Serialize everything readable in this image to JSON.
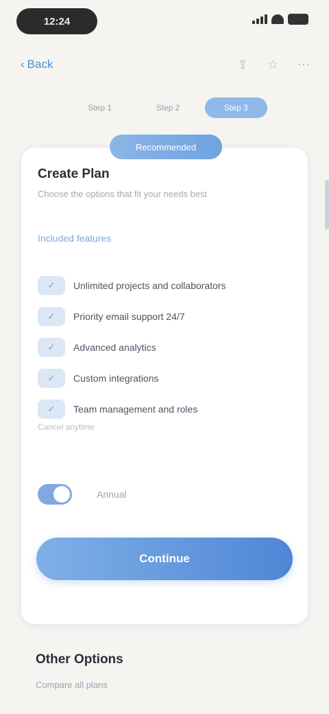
{
  "status": {
    "time": "12:24"
  },
  "nav": {
    "back_label": "Back",
    "icons": [
      "share-icon",
      "star-icon",
      "more-icon"
    ]
  },
  "steps": {
    "tabs": [
      "Step 1",
      "Step 2",
      "Step 3"
    ],
    "active_index": 2
  },
  "card": {
    "badge": "Recommended",
    "title": "Create Plan",
    "subtitle": "Choose the options that fit your needs best",
    "section_label": "Included features",
    "items": [
      {
        "icon": "✓",
        "text": "Unlimited projects and collaborators"
      },
      {
        "icon": "✓",
        "text": "Priority email support 24/7"
      },
      {
        "icon": "✓",
        "text": "Advanced analytics"
      },
      {
        "icon": "✓",
        "text": "Custom integrations"
      },
      {
        "icon": "✓",
        "text": "Team management and roles"
      }
    ],
    "footnote": "Cancel anytime",
    "toggle_label": "Annual",
    "toggle_on": true,
    "cta_label": "Continue"
  },
  "bottom": {
    "title": "Other Options",
    "subtitle": "Compare all plans"
  },
  "colors": {
    "accent": "#4f86d6",
    "accent_light": "#8cb6e6",
    "background": "#f5f4f1"
  }
}
